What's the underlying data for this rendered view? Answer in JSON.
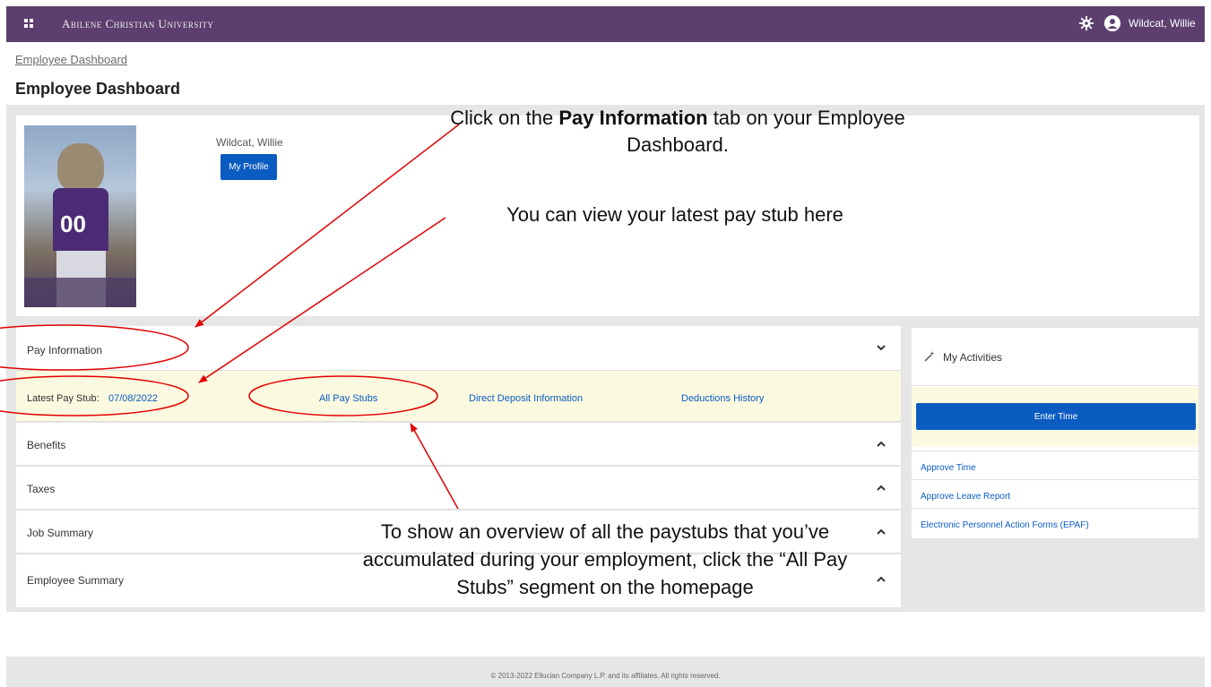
{
  "header": {
    "university": "Abilene Christian University",
    "user_name": "Wildcat, Willie"
  },
  "breadcrumb": "Employee Dashboard",
  "page_title": "Employee Dashboard",
  "profile": {
    "name": "Wildcat, Willie",
    "button": "My Profile",
    "photo_jersey": "00"
  },
  "pay_information": {
    "title": "Pay Information",
    "latest_label": "Latest Pay Stub:",
    "latest_date": "07/08/2022",
    "links": [
      "All Pay Stubs",
      "Direct Deposit Information",
      "Deductions History"
    ]
  },
  "sections": [
    "Benefits",
    "Taxes",
    "Job Summary",
    "Employee Summary"
  ],
  "activities": {
    "title": "My Activities",
    "enter_time": "Enter Time",
    "links": [
      "Approve Time",
      "Approve Leave Report",
      "Electronic Personnel Action Forms (EPAF)"
    ]
  },
  "footer": "© 2013-2022 Ellucian Company L.P. and its affiliates. All rights reserved.",
  "annotations": {
    "note1_pre": "Click on the ",
    "note1_bold": "Pay Information",
    "note1_post": " tab on your Employee Dashboard.",
    "note2": "You can view your latest pay stub here",
    "note3": "To show an overview of all the paystubs that you’ve accumulated during your employment, click the “All Pay Stubs” segment on the homepage"
  },
  "colors": {
    "topbar": "#5c3f6e",
    "accent_blue": "#0b5cc1",
    "highlight_yellow": "#fbf9e0",
    "annotation_red": "#e30000"
  }
}
